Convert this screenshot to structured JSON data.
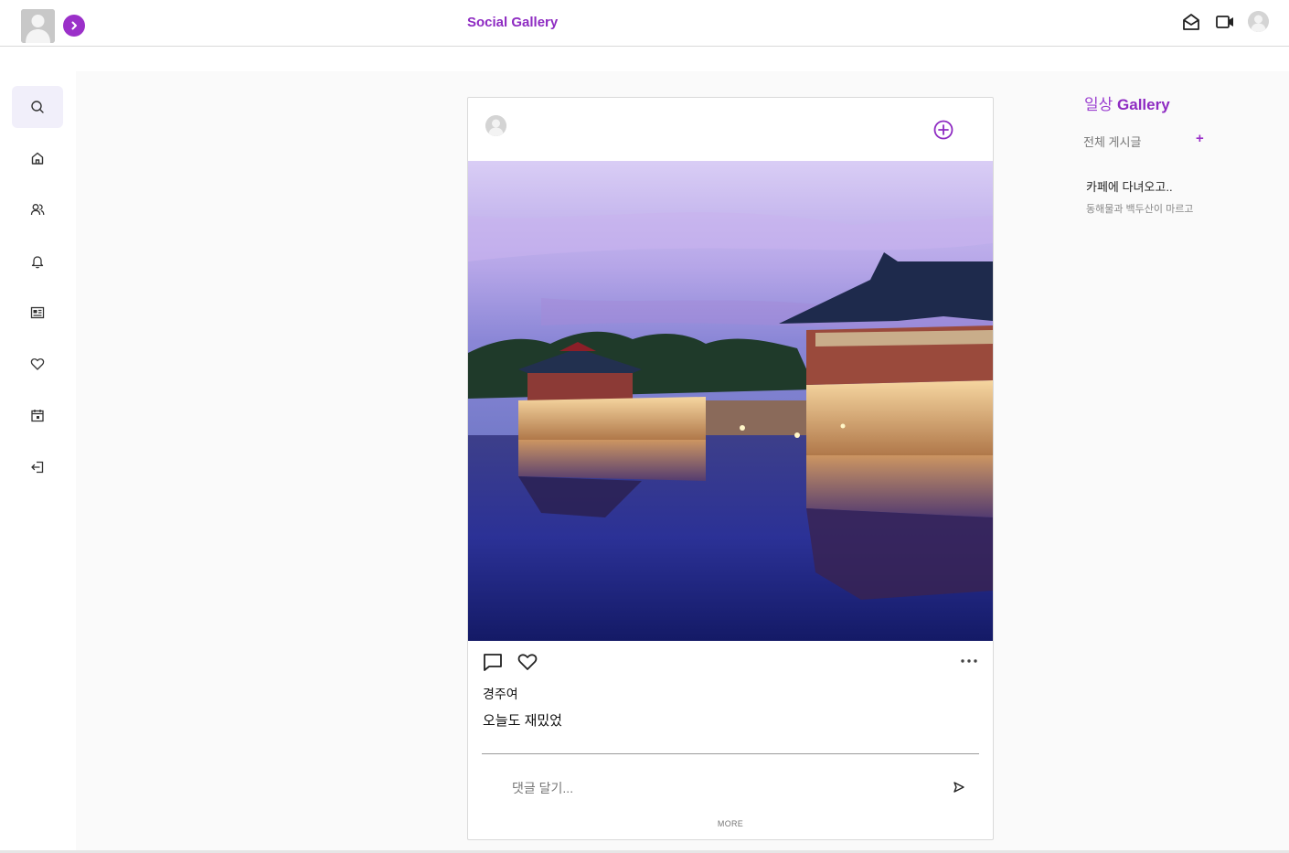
{
  "header": {
    "title": "Social Gallery",
    "icons": [
      "mail-open-icon",
      "video-icon",
      "user-avatar-icon"
    ]
  },
  "sidebar": {
    "items": [
      {
        "icon": "search-icon",
        "active": true
      },
      {
        "icon": "home-icon"
      },
      {
        "icon": "users-icon"
      },
      {
        "icon": "bell-icon"
      },
      {
        "icon": "newspaper-icon"
      },
      {
        "icon": "heart-icon"
      },
      {
        "icon": "calendar-icon"
      },
      {
        "icon": "logout-icon"
      }
    ]
  },
  "post": {
    "title": "경주여",
    "body": "오늘도 재밌었",
    "comment_placeholder": "댓글 달기...",
    "more_label": "MORE"
  },
  "right_panel": {
    "title_prefix": "일상",
    "title_suffix": "Gallery",
    "all_posts_label": "전체 게시글",
    "add_label": "+",
    "recent_post_title": "카페에 다녀오고..",
    "recent_post_excerpt": "동해물과 백두산이 마르고"
  },
  "colors": {
    "accent": "#8e2bc2",
    "accent_bg": "#9b30c9",
    "main_bg": "#fafafa"
  }
}
